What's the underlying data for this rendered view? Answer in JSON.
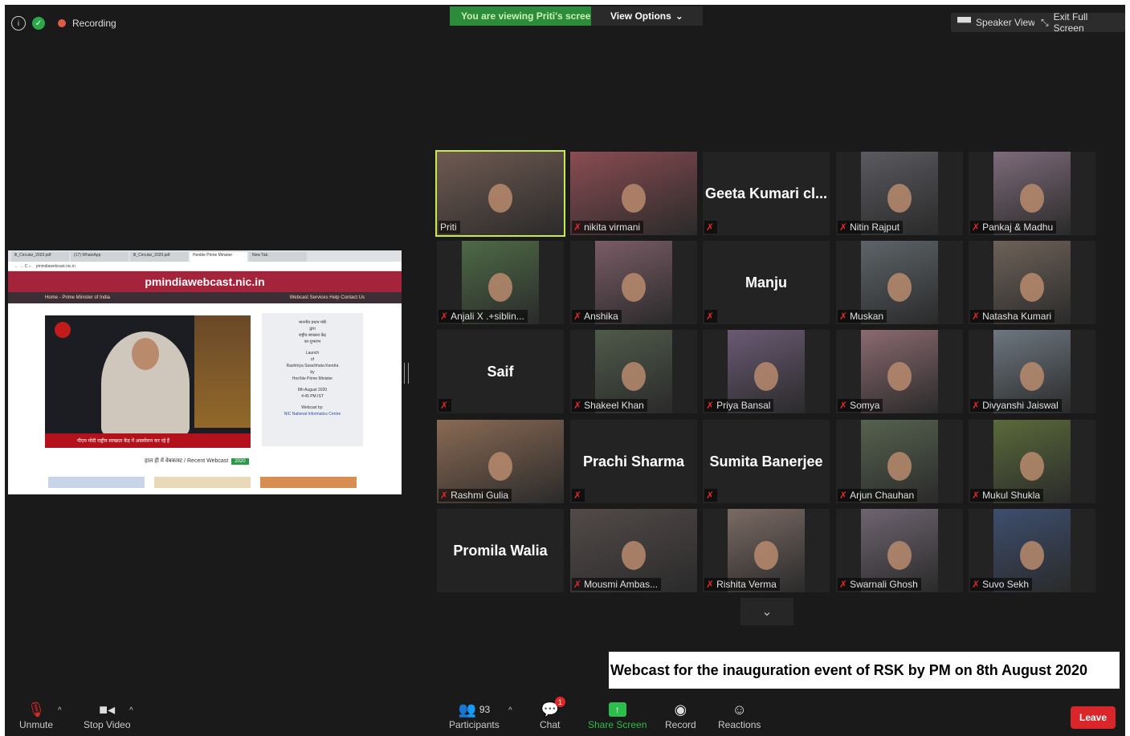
{
  "top": {
    "recording": "Recording",
    "viewing": "You are viewing Priti's screen",
    "view_options": "View Options",
    "speaker_view": "Speaker View",
    "exit_full_screen": "Exit Full Screen"
  },
  "shared": {
    "tabs": [
      "lll_Circular_2020.pdf",
      "(17) WhatsApp",
      "lll_Circular_2020.pdf",
      "Honble Prime Minister",
      "New Tab"
    ],
    "url": "pmindiawebcast.nic.in",
    "site_title": "pmindiawebcast.nic.in",
    "nav_left": "Home - Prime Minister of India",
    "nav_right": "Webcast Services   Help   Contact Us",
    "ticker": "पीएम मोदी राष्ट्रीय स्वच्छता केंद्र में अवलोकन कर रहे हैं",
    "invite_lines": [
      "माननीय प्रधान मंत्री",
      "द्वारा",
      "राष्ट्रीय स्वच्छता केंद्र",
      "का शुभारंभ",
      "Launch",
      "of",
      "Rashtriya Swachhata Kendra",
      "by",
      "Hon'ble Prime Minister",
      "8th August 2020",
      "4:45 PM IST",
      "Webcast by:",
      "NIC National Informatics Centre"
    ],
    "recent": "हाल ही में वेबकास्ट / Recent Webcast",
    "year": "2020"
  },
  "participants": [
    {
      "name": "Priti",
      "type": "video",
      "muted": false
    },
    {
      "name": "nikita virmani",
      "type": "video",
      "muted": true
    },
    {
      "name": "Geeta Kumari cl...",
      "type": "name",
      "muted": true
    },
    {
      "name": "Nitin Rajput",
      "type": "video",
      "muted": true
    },
    {
      "name": "Pankaj & Madhu",
      "type": "video",
      "muted": true
    },
    {
      "name": "Anjali X .+siblin...",
      "type": "video",
      "muted": true
    },
    {
      "name": "Anshika",
      "type": "video",
      "muted": true
    },
    {
      "name": "Manju",
      "type": "name",
      "muted": true
    },
    {
      "name": "Muskan",
      "type": "video",
      "muted": true
    },
    {
      "name": "Natasha Kumari",
      "type": "video",
      "muted": true
    },
    {
      "name": "Saif",
      "type": "name",
      "muted": true
    },
    {
      "name": "Shakeel Khan",
      "type": "video",
      "muted": true
    },
    {
      "name": "Priya Bansal",
      "type": "video",
      "muted": true
    },
    {
      "name": "Somya",
      "type": "video",
      "muted": true
    },
    {
      "name": "Divyanshi Jaiswal",
      "type": "video",
      "muted": true
    },
    {
      "name": "Rashmi Gulia",
      "type": "video",
      "muted": true
    },
    {
      "name": "Prachi Sharma",
      "type": "name",
      "muted": true
    },
    {
      "name": "Sumita Banerjee",
      "type": "name",
      "muted": true
    },
    {
      "name": "Arjun Chauhan",
      "type": "video",
      "muted": true
    },
    {
      "name": "Mukul Shukla",
      "type": "video",
      "muted": true
    },
    {
      "name": "Promila Walia",
      "type": "name",
      "muted": false
    },
    {
      "name": "Mousmi Ambas...",
      "type": "video",
      "muted": true
    },
    {
      "name": "Rishita Verma",
      "type": "video",
      "muted": true
    },
    {
      "name": "Swarnali Ghosh",
      "type": "video",
      "muted": true
    },
    {
      "name": "Suvo Sekh",
      "type": "video",
      "muted": true
    }
  ],
  "caption": "Webcast for the inauguration event of RSK by PM on 8th August 2020",
  "toolbar": {
    "unmute": "Unmute",
    "stop_video": "Stop Video",
    "participants": "Participants",
    "participants_count": "93",
    "chat": "Chat",
    "chat_badge": "1",
    "share_screen": "Share Screen",
    "record": "Record",
    "reactions": "Reactions",
    "leave": "Leave"
  },
  "colors": {
    "speaking_outline": "#c8ea4a",
    "viewing_bg": "#2d8c3c",
    "leave": "#d9262a",
    "share_screen": "#2dbd4a",
    "mic_muted": "#e02828"
  }
}
